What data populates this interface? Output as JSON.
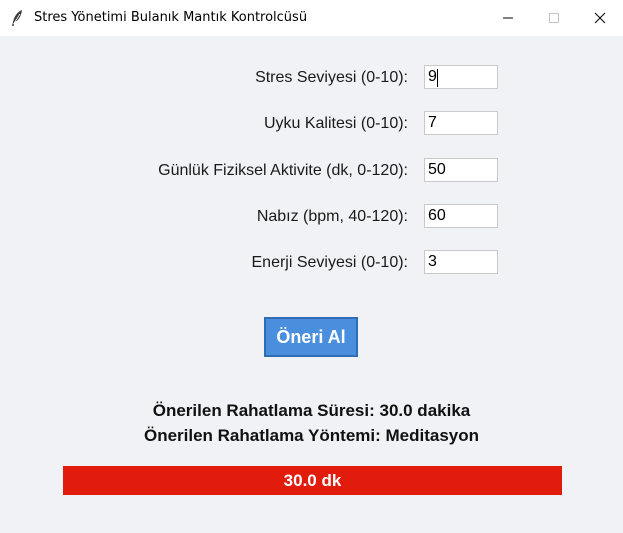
{
  "window": {
    "title": "Stres Yönetimi Bulanık Mantık Kontrolcüsü",
    "app_icon": "feather-icon"
  },
  "form": {
    "fields": [
      {
        "label": "Stres Seviyesi (0-10):",
        "value": "9"
      },
      {
        "label": "Uyku Kalitesi (0-10):",
        "value": "7"
      },
      {
        "label": "Günlük Fiziksel Aktivite (dk, 0-120):",
        "value": "50"
      },
      {
        "label": "Nabız (bpm, 40-120):",
        "value": "60"
      },
      {
        "label": "Enerji Seviyesi (0-10):",
        "value": "3"
      }
    ],
    "submit_label": "Öneri Al"
  },
  "results": {
    "duration_text": "Önerilen Rahatlama Süresi: 30.0 dakika",
    "method_text": "Önerilen Rahatlama Yöntemi: Meditasyon"
  },
  "bar": {
    "label": "30.0 dk",
    "color": "#e11c0d"
  },
  "colors": {
    "background": "#f0f2f5",
    "button": "#4a8fde"
  }
}
